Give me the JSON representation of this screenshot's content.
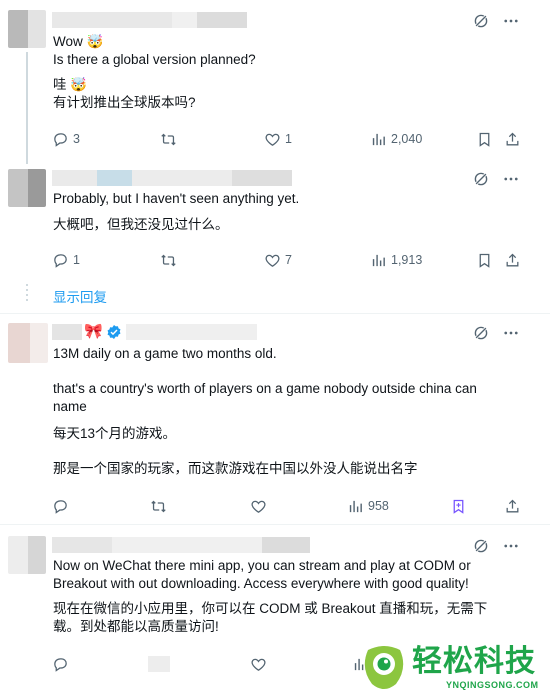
{
  "replies": [
    {
      "lines": [
        "Wow 🤯",
        "Is there a global version planned?"
      ],
      "translation": [
        "哇 🤯",
        "有计划推出全球版本吗?"
      ],
      "stats": {
        "replies": "3",
        "reposts": "",
        "likes": "1",
        "views": "2,040"
      }
    },
    {
      "lines": [
        "Probably, but I haven't seen anything yet."
      ],
      "translation": [
        "大概吧，但我还没见过什么。"
      ],
      "stats": {
        "replies": "1",
        "reposts": "",
        "likes": "7",
        "views": "1,913"
      },
      "show_replies": "显示回复"
    },
    {
      "lines": [
        "13M daily on a game two months old.",
        "",
        "that's a country's worth of players on a game nobody outside china can name"
      ],
      "translation": [
        "每天13个月的游戏。",
        "",
        "那是一个国家的玩家，而这款游戏在中国以外没人能说出名字"
      ],
      "stats": {
        "replies": "",
        "reposts": "",
        "likes": "",
        "views": "958"
      },
      "badge": "🎀"
    },
    {
      "lines": [
        "Now on WeChat there mini app, you can stream and play at CODM or Breakout with out downloading. Access everywhere with good quality!"
      ],
      "translation": [
        "现在在微信的小应用里，你可以在 CODM 或 Breakout 直播和玩，无需下载。到处都能以高质量访问!"
      ],
      "stats": {
        "replies": "",
        "reposts": "",
        "likes": "",
        "views": ""
      }
    }
  ],
  "watermark": {
    "cn": "轻松科技",
    "en": "YNQINGSONG.COM"
  },
  "colors": {
    "accent": "#1d9bf0",
    "muted": "#536471",
    "bookmark_active": "#7856ff",
    "watermark": "#1fa54a"
  }
}
